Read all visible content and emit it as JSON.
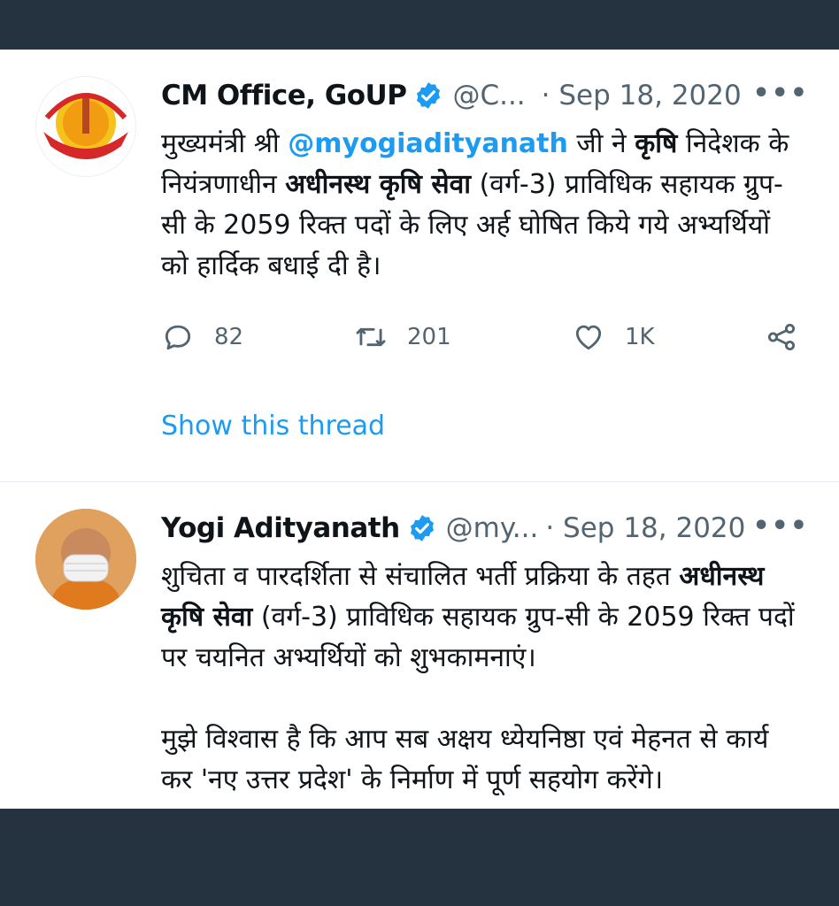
{
  "tweets": [
    {
      "author": "CM Office, GoUP",
      "handle": "@C...",
      "date": "· Sep 18, 2020",
      "more": "•••",
      "body": {
        "p1": "मुख्यमंत्री श्री ",
        "mention": "@myogiadityanath",
        "p2": " जी ने ",
        "b1": "कृषि",
        "p3": " निदेशक के नियंत्रणाधीन ",
        "b2": "अधीनस्थ कृषि सेवा",
        "p4": " (वर्ग-3) प्राविधिक सहायक ग्रुप-सी के 2059 रिक्त पदों के लिए अर्ह घोषित किये गये अभ्यर्थियों को हार्दिक बधाई दी है।"
      },
      "stats": {
        "replies": "82",
        "retweets": "201",
        "likes": "1K"
      },
      "show_thread": "Show this thread"
    },
    {
      "author": "Yogi Adityanath",
      "handle": "@my...",
      "date": "· Sep 18, 2020",
      "more": "•••",
      "body": {
        "p1": "शुचिता व पारदर्शिता से संचालित भर्ती प्रक्रिया के तहत ",
        "b1": "अधीनस्थ कृषि सेवा",
        "p2": " (वर्ग-3) प्राविधिक सहायक ग्रुप-सी के 2059 रिक्त पदों पर चयनित अभ्यर्थियों को शुभकामनाएं।",
        "p3": "मुझे विश्वास है कि आप सब अक्षय ध्येयनिष्ठा एवं मेहनत से कार्य कर 'नए उत्तर प्रदेश' के निर्माण में पूर्ण सहयोग करेंगे।"
      }
    }
  ],
  "icons": {
    "verified": "verified-badge-icon",
    "reply": "reply-icon",
    "retweet": "retweet-icon",
    "like": "heart-icon",
    "share": "share-icon",
    "more": "more-icon"
  },
  "colors": {
    "link": "#1d9bf0",
    "muted": "#536471",
    "background_frame": "#253341"
  }
}
